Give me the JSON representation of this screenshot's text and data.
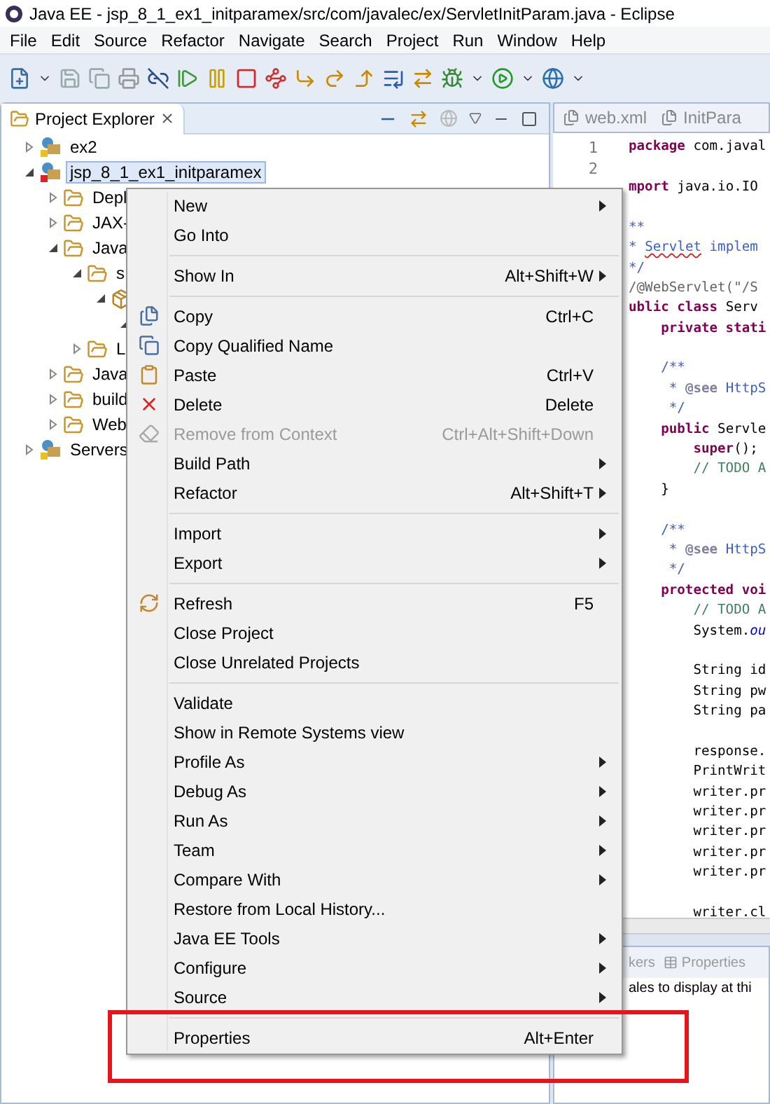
{
  "window": {
    "title": "Java EE - jsp_8_1_ex1_initparamex/src/com/javalec/ex/ServletInitParam.java - Eclipse"
  },
  "menu_bar": [
    "File",
    "Edit",
    "Source",
    "Refactor",
    "Navigate",
    "Search",
    "Project",
    "Run",
    "Window",
    "Help"
  ],
  "project_explorer": {
    "title": "Project Explorer",
    "tree": [
      {
        "label": "ex2",
        "expanded": false,
        "selected": false
      },
      {
        "label": "jsp_8_1_ex1_initparamex",
        "expanded": true,
        "selected": true,
        "children": [
          {
            "label": "Depl",
            "expanded": false,
            "selected": false
          },
          {
            "label": "JAX-",
            "expanded": false,
            "selected": false
          },
          {
            "label": "Java",
            "expanded": true,
            "selected": false,
            "children": [
              {
                "label": "s",
                "expanded": true,
                "selected": false,
                "children": [
                  {
                    "expanded": true,
                    "children": [
                      {
                        "expanded": true
                      }
                    ]
                  }
                ]
              },
              {
                "label": "L",
                "expanded": false,
                "selected": false
              }
            ]
          },
          {
            "label": "Java",
            "expanded": false,
            "selected": false
          },
          {
            "label": "build",
            "expanded": false,
            "selected": false
          },
          {
            "label": "Web",
            "expanded": false,
            "selected": false
          }
        ]
      },
      {
        "label": "Servers",
        "expanded": false,
        "selected": false
      }
    ]
  },
  "editor": {
    "tabs": [
      {
        "label": "web.xml",
        "selected": false
      },
      {
        "label": "InitPara",
        "selected": false
      }
    ],
    "lines": [
      {
        "kind": "code",
        "number": "1",
        "parts": [
          {
            "text": "package",
            "kind": "keyword"
          },
          {
            "text": " com.javal",
            "kind": "plain"
          }
        ]
      },
      {
        "kind": "blank",
        "number": "2"
      },
      {
        "kind": "code",
        "parts": [
          {
            "text": "mport",
            "kind": "keyword"
          },
          {
            "text": " java.io.IO",
            "kind": "plain"
          }
        ]
      },
      {
        "kind": "blank"
      },
      {
        "kind": "code",
        "parts": [
          {
            "text": "**",
            "kind": "javadoc"
          }
        ]
      },
      {
        "kind": "code",
        "parts": [
          {
            "text": "* ",
            "kind": "javadoc"
          },
          {
            "text": "Servlet",
            "kind": "misspelled"
          },
          {
            "text": " implem",
            "kind": "javadoc"
          }
        ]
      },
      {
        "kind": "code",
        "parts": [
          {
            "text": "*/",
            "kind": "javadoc"
          }
        ]
      },
      {
        "kind": "code",
        "parts": [
          {
            "text": "/@WebServlet(\"/S",
            "kind": "annotation"
          }
        ]
      },
      {
        "kind": "code",
        "parts": [
          {
            "text": "ublic class",
            "kind": "keyword"
          },
          {
            "text": " Serv",
            "kind": "plain"
          }
        ]
      },
      {
        "kind": "code",
        "parts": [
          {
            "text": "    private stati",
            "kind": "keyword"
          }
        ]
      },
      {
        "kind": "blank"
      },
      {
        "kind": "code",
        "parts": [
          {
            "text": "    /**",
            "kind": "javadoc"
          }
        ]
      },
      {
        "kind": "code",
        "parts": [
          {
            "text": "     * ",
            "kind": "javadoc"
          },
          {
            "text": "@see",
            "kind": "tag"
          },
          {
            "text": " HttpS",
            "kind": "javadoc"
          }
        ]
      },
      {
        "kind": "code",
        "parts": [
          {
            "text": "     */",
            "kind": "javadoc"
          }
        ]
      },
      {
        "kind": "code",
        "parts": [
          {
            "text": "    public",
            "kind": "keyword"
          },
          {
            "text": " Servle",
            "kind": "plain"
          }
        ]
      },
      {
        "kind": "code",
        "parts": [
          {
            "text": "        super",
            "kind": "keyword"
          },
          {
            "text": "();",
            "kind": "plain"
          }
        ]
      },
      {
        "kind": "code",
        "parts": [
          {
            "text": "        // TODO A",
            "kind": "comment"
          }
        ]
      },
      {
        "kind": "code",
        "parts": [
          {
            "text": "    }",
            "kind": "plain"
          }
        ]
      },
      {
        "kind": "blank"
      },
      {
        "kind": "code",
        "parts": [
          {
            "text": "    /**",
            "kind": "javadoc"
          }
        ]
      },
      {
        "kind": "code",
        "parts": [
          {
            "text": "     * ",
            "kind": "javadoc"
          },
          {
            "text": "@see",
            "kind": "tag"
          },
          {
            "text": " HttpS",
            "kind": "javadoc"
          }
        ]
      },
      {
        "kind": "code",
        "parts": [
          {
            "text": "     */",
            "kind": "javadoc"
          }
        ]
      },
      {
        "kind": "code",
        "parts": [
          {
            "text": "    protected voi",
            "kind": "keyword"
          }
        ]
      },
      {
        "kind": "code",
        "parts": [
          {
            "text": "        // TODO A",
            "kind": "comment"
          }
        ]
      },
      {
        "kind": "code",
        "parts": [
          {
            "text": "        System.",
            "kind": "plain"
          },
          {
            "text": "ou",
            "kind": "field"
          }
        ]
      },
      {
        "kind": "blank"
      },
      {
        "kind": "code",
        "parts": [
          {
            "text": "        String id",
            "kind": "plain"
          }
        ]
      },
      {
        "kind": "code",
        "parts": [
          {
            "text": "        String pw",
            "kind": "plain"
          }
        ]
      },
      {
        "kind": "code",
        "parts": [
          {
            "text": "        String pa",
            "kind": "plain"
          }
        ]
      },
      {
        "kind": "blank"
      },
      {
        "kind": "code",
        "parts": [
          {
            "text": "        response.",
            "kind": "plain"
          }
        ]
      },
      {
        "kind": "code",
        "parts": [
          {
            "text": "        PrintWrit",
            "kind": "plain"
          }
        ]
      },
      {
        "kind": "code",
        "parts": [
          {
            "text": "        writer.pr",
            "kind": "plain"
          }
        ]
      },
      {
        "kind": "code",
        "parts": [
          {
            "text": "        writer.pr",
            "kind": "plain"
          }
        ]
      },
      {
        "kind": "code",
        "parts": [
          {
            "text": "        writer.pr",
            "kind": "plain"
          }
        ]
      },
      {
        "kind": "code",
        "parts": [
          {
            "text": "        writer.pr",
            "kind": "plain"
          }
        ]
      },
      {
        "kind": "code",
        "parts": [
          {
            "text": "        writer.pr",
            "kind": "plain"
          }
        ]
      },
      {
        "kind": "blank"
      },
      {
        "kind": "code",
        "parts": [
          {
            "text": "        writer.cl",
            "kind": "plain"
          }
        ]
      }
    ]
  },
  "bottom_panel": {
    "tabs": [
      {
        "label": "kers",
        "selected": false
      },
      {
        "label": "Properties",
        "selected": false
      }
    ],
    "message": "ales to display at thi"
  },
  "context_menu": {
    "items": [
      {
        "kind": "item",
        "label": "New",
        "submenu": true,
        "disabled": false
      },
      {
        "kind": "item",
        "label": "Go Into",
        "submenu": false,
        "disabled": false
      },
      {
        "kind": "separator"
      },
      {
        "kind": "item",
        "label": "Show In",
        "shortcut": "Alt+Shift+W",
        "submenu": true,
        "disabled": false
      },
      {
        "kind": "separator"
      },
      {
        "kind": "item",
        "label": "Copy",
        "shortcut": "Ctrl+C",
        "submenu": false,
        "disabled": false
      },
      {
        "kind": "item",
        "label": "Copy Qualified Name",
        "submenu": false,
        "disabled": false
      },
      {
        "kind": "item",
        "label": "Paste",
        "shortcut": "Ctrl+V",
        "submenu": false,
        "disabled": false
      },
      {
        "kind": "item",
        "label": "Delete",
        "shortcut": "Delete",
        "submenu": false,
        "disabled": false
      },
      {
        "kind": "item",
        "label": "Remove from Context",
        "shortcut": "Ctrl+Alt+Shift+Down",
        "submenu": false,
        "disabled": true
      },
      {
        "kind": "item",
        "label": "Build Path",
        "submenu": true,
        "disabled": false
      },
      {
        "kind": "item",
        "label": "Refactor",
        "shortcut": "Alt+Shift+T",
        "submenu": true,
        "disabled": false
      },
      {
        "kind": "separator"
      },
      {
        "kind": "item",
        "label": "Import",
        "submenu": true,
        "disabled": false
      },
      {
        "kind": "item",
        "label": "Export",
        "submenu": true,
        "disabled": false
      },
      {
        "kind": "separator"
      },
      {
        "kind": "item",
        "label": "Refresh",
        "shortcut": "F5",
        "submenu": false,
        "disabled": false
      },
      {
        "kind": "item",
        "label": "Close Project",
        "submenu": false,
        "disabled": false
      },
      {
        "kind": "item",
        "label": "Close Unrelated Projects",
        "submenu": false,
        "disabled": false
      },
      {
        "kind": "separator"
      },
      {
        "kind": "item",
        "label": "Validate",
        "submenu": false,
        "disabled": false
      },
      {
        "kind": "item",
        "label": "Show in Remote Systems view",
        "submenu": false,
        "disabled": false
      },
      {
        "kind": "item",
        "label": "Profile As",
        "submenu": true,
        "disabled": false
      },
      {
        "kind": "item",
        "label": "Debug As",
        "submenu": true,
        "disabled": false
      },
      {
        "kind": "item",
        "label": "Run As",
        "submenu": true,
        "disabled": false
      },
      {
        "kind": "item",
        "label": "Team",
        "submenu": true,
        "disabled": false
      },
      {
        "kind": "item",
        "label": "Compare With",
        "submenu": true,
        "disabled": false
      },
      {
        "kind": "item",
        "label": "Restore from Local History...",
        "submenu": false,
        "disabled": false
      },
      {
        "kind": "item",
        "label": "Java EE Tools",
        "submenu": true,
        "disabled": false
      },
      {
        "kind": "item",
        "label": "Configure",
        "submenu": true,
        "disabled": false
      },
      {
        "kind": "item",
        "label": "Source",
        "submenu": true,
        "disabled": false
      },
      {
        "kind": "separator"
      },
      {
        "kind": "item",
        "label": "Properties",
        "shortcut": "Alt+Enter",
        "submenu": false,
        "disabled": false
      }
    ]
  },
  "highlight_box": {
    "visible": true
  }
}
